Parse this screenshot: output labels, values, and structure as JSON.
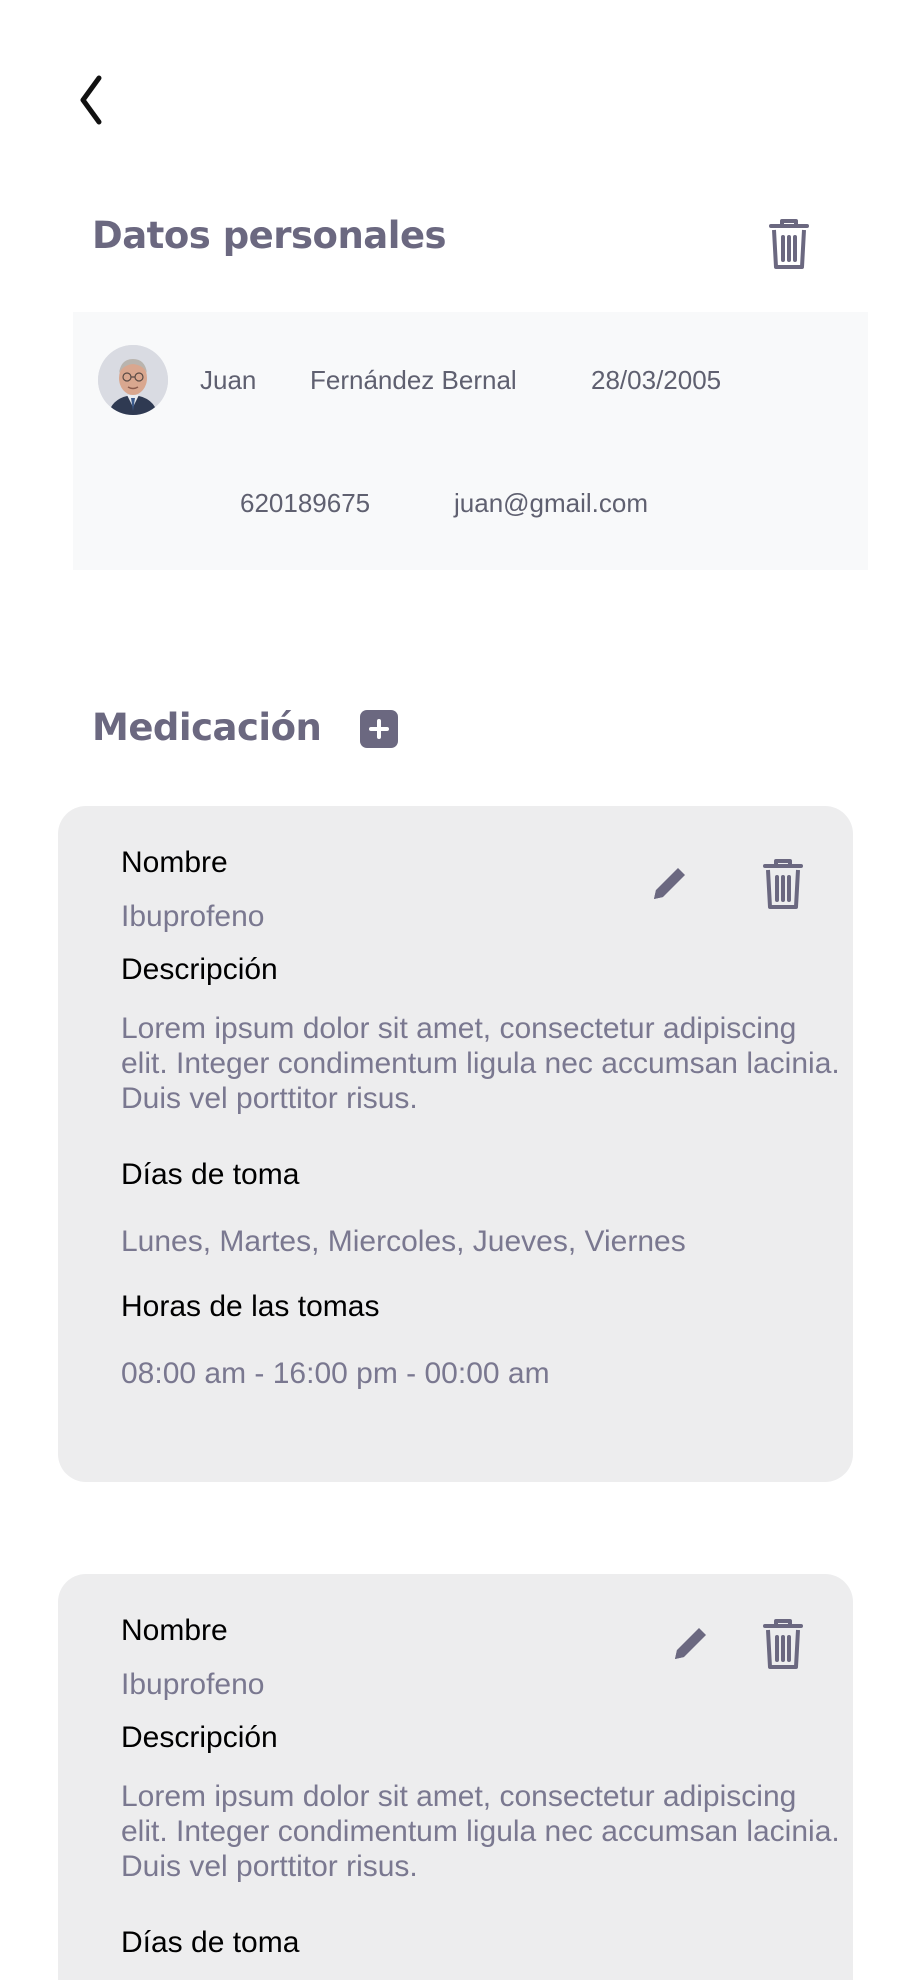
{
  "nav": {
    "back_icon": "chevron-left-icon"
  },
  "personal": {
    "title": "Datos personales",
    "delete_icon": "trash-icon",
    "first_name": "Juan",
    "last_name": "Fernández Bernal",
    "birth_date": "28/03/2005",
    "phone": "620189675",
    "email": "juan@gmail.com"
  },
  "medication": {
    "title": "Medicación",
    "add_icon": "plus-square-icon",
    "items": [
      {
        "name_label": "Nombre",
        "name": "Ibuprofeno",
        "description_label": "Descripción",
        "description": "Lorem ipsum dolor sit amet, consectetur adipiscing elit. Integer condimentum ligula nec accumsan lacinia. Duis vel porttitor risus.",
        "days_label": "Días de toma",
        "days": "Lunes, Martes, Miercoles, Jueves, Viernes",
        "hours_label": "Horas de las tomas",
        "hours": "08:00 am - 16:00 pm - 00:00 am"
      },
      {
        "name_label": "Nombre",
        "name": "Ibuprofeno",
        "description_label": "Descripción",
        "description": "Lorem ipsum dolor sit amet, consectetur adipiscing elit. Integer condimentum ligula nec accumsan lacinia. Duis vel porttitor risus.",
        "days_label": "Días de toma"
      }
    ]
  },
  "colors": {
    "title": "#6b6880",
    "secondary_text": "#7a7890",
    "card_bg": "#ededee",
    "personal_bg": "#f8f9fa"
  }
}
